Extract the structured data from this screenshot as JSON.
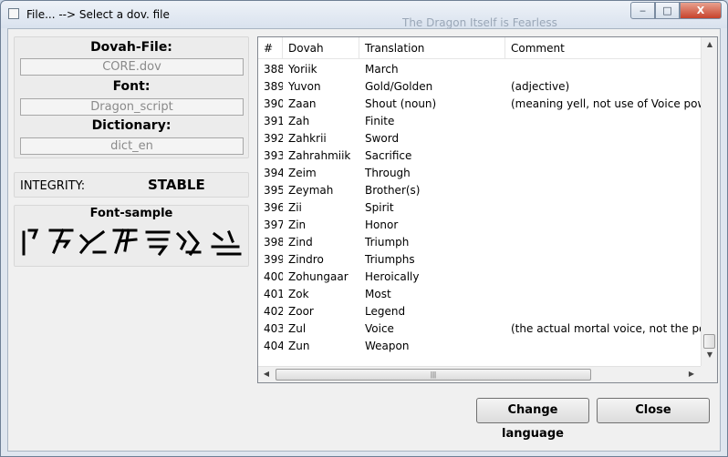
{
  "window": {
    "title": "File... --> Select a dov. file",
    "background_title": "The Dragon Itself is Fearless",
    "min_label": "‒",
    "max_label": "□",
    "close_label": "X"
  },
  "left": {
    "dovah_file_label": "Dovah-File:",
    "dovah_file_value": "CORE.dov",
    "font_label": "Font:",
    "font_value": "Dragon_script",
    "dictionary_label": "Dictionary:",
    "dictionary_value": "dict_en",
    "integrity_label": "INTEGRITY:",
    "integrity_value": "STABLE",
    "font_sample_label": "Font-sample"
  },
  "table": {
    "columns": [
      "#",
      "Dovah",
      "Translation",
      "Comment"
    ],
    "rows": [
      {
        "num": "388",
        "dovah": "Yoriik",
        "translation": "March",
        "comment": ""
      },
      {
        "num": "389",
        "dovah": "Yuvon",
        "translation": "Gold/Golden",
        "comment": "(adjective)"
      },
      {
        "num": "390",
        "dovah": "Zaan",
        "translation": "Shout (noun)",
        "comment": "(meaning yell, not use of Voice power)"
      },
      {
        "num": "391",
        "dovah": "Zah",
        "translation": "Finite",
        "comment": ""
      },
      {
        "num": "392",
        "dovah": "Zahkrii",
        "translation": "Sword",
        "comment": ""
      },
      {
        "num": "393",
        "dovah": "Zahrahmiik",
        "translation": "Sacrifice",
        "comment": ""
      },
      {
        "num": "394",
        "dovah": "Zeim",
        "translation": "Through",
        "comment": ""
      },
      {
        "num": "395",
        "dovah": "Zeymah",
        "translation": "Brother(s)",
        "comment": ""
      },
      {
        "num": "396",
        "dovah": "Zii",
        "translation": "Spirit",
        "comment": ""
      },
      {
        "num": "397",
        "dovah": "Zin",
        "translation": "Honor",
        "comment": ""
      },
      {
        "num": "398",
        "dovah": "Zind",
        "translation": "Triumph",
        "comment": ""
      },
      {
        "num": "399",
        "dovah": "Zindro",
        "translation": "Triumphs",
        "comment": ""
      },
      {
        "num": "400",
        "dovah": "Zohungaar",
        "translation": "Heroically",
        "comment": ""
      },
      {
        "num": "401",
        "dovah": "Zok",
        "translation": "Most",
        "comment": ""
      },
      {
        "num": "402",
        "dovah": "Zoor",
        "translation": "Legend",
        "comment": ""
      },
      {
        "num": "403",
        "dovah": "Zul",
        "translation": "Voice",
        "comment": "(the actual mortal voice, not the power"
      },
      {
        "num": "404",
        "dovah": "Zun",
        "translation": "Weapon",
        "comment": ""
      }
    ],
    "scroll_up": "▲",
    "scroll_down": "▼",
    "scroll_left": "◀",
    "scroll_right": "▶",
    "grip": "|||"
  },
  "buttons": {
    "change_language": "Change language",
    "close": "Close"
  },
  "colors": {
    "window_frame": "#dfe6ef",
    "client_bg": "#f0f0f0",
    "close_button": "#c7432b"
  }
}
